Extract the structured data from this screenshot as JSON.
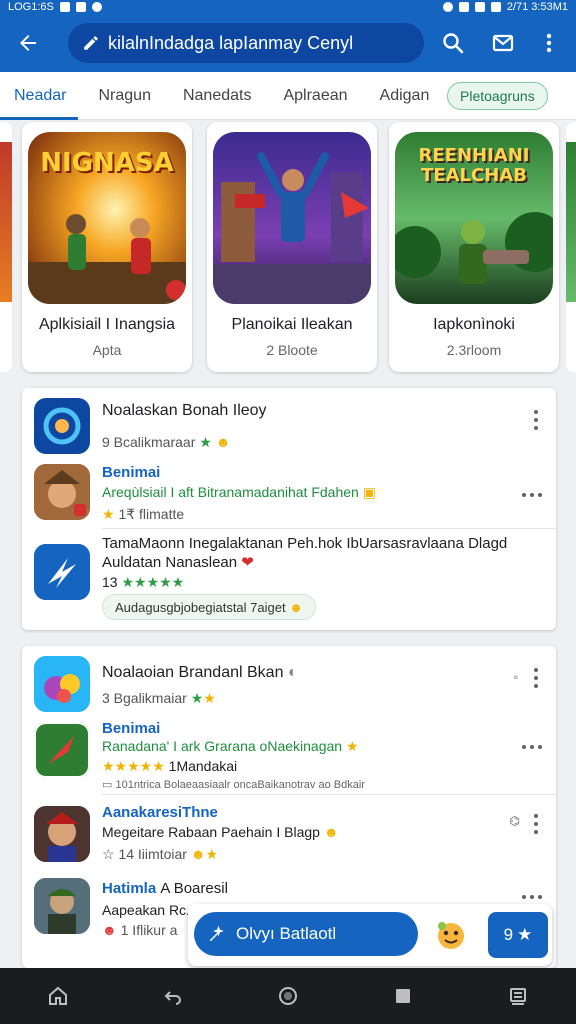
{
  "status_bar": {
    "time_left": "LOG1:6S",
    "time_right": "2/71 3:53M1"
  },
  "search": {
    "query": "kilalnIndadga lapIanmay Cenyl"
  },
  "tabs": [
    {
      "label": "Neadar",
      "active": true
    },
    {
      "label": "Nragun",
      "active": false
    },
    {
      "label": "Nanedats",
      "active": false
    },
    {
      "label": "Aplraean",
      "active": false
    },
    {
      "label": "Adigan",
      "active": false
    }
  ],
  "tab_chip": "Pletoagruns",
  "featured": [
    {
      "title": "Aplkisiail I Inangsia",
      "sub": "Apta",
      "art_text": "NIGNASA",
      "theme": "orange"
    },
    {
      "title": "Planoikai Ileakan",
      "sub": "2 Bloote",
      "art_text": "",
      "theme": "purple"
    },
    {
      "title": "Iapkonìnoki",
      "sub": "2.3rloom",
      "art_text": "REENHIANI TEALCHAB",
      "theme": "green"
    }
  ],
  "card1": {
    "rows": [
      {
        "name": "Noalaskan Bonah Ileoy",
        "sub": "9 Bcalikmaraar"
      },
      {
        "name": "Benimai",
        "sub": "Areqùlsiail I aft Bitranamadanihat Fdahen",
        "rating": "1₹ flimatte"
      },
      {
        "name": "TamaMaonn Inegalaktanan Peh.hok IbUarsasravlaana Dlagd Auldatan Nanaslean",
        "rating": "13",
        "stars": "★★★★★",
        "pill": "Audagusgbjobegiatstal 7aiget"
      }
    ]
  },
  "card2": {
    "rows": [
      {
        "name": "Noalaoian Brandanl Bkan",
        "sub": "3 Bgalikmaiar"
      },
      {
        "name": "Benimai",
        "sub": "Ranadana' I ark Grarana oNaekinagan",
        "stars": "★★★★★",
        "rating": "1Mandakai",
        "extra": "101ntrica Bolaeaasiaalr oncaBaikanotrav ao Bdkair"
      },
      {
        "name": "AanakaresiThne",
        "sub": "Megeitare Rabaan Paehain I Blagp",
        "rating": "14 Iiimtoiar"
      },
      {
        "name": "Hatimla",
        "name_extra": "A Boaresil",
        "sub": "Aapeakan Rc...",
        "rating": "1 Iflikur a"
      }
    ]
  },
  "fab": {
    "label": "Olvyı Batlaotl",
    "count": "9"
  },
  "colors": {
    "primary": "#1565c0",
    "primary_dark": "#0d47a1",
    "accent_green": "#1e8e3e",
    "nav_bar": "#1b1c1f"
  },
  "icons": [
    "back-arrow-icon",
    "search-icon",
    "mail-icon",
    "more-vert-icon",
    "home-icon",
    "back-icon",
    "circle-icon",
    "square-icon",
    "recents-icon"
  ]
}
